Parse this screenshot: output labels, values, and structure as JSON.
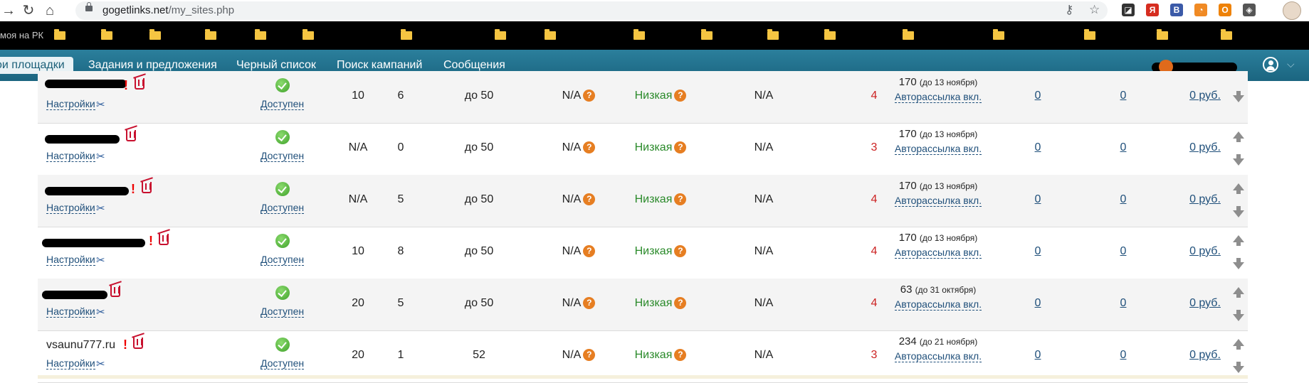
{
  "browser": {
    "url_host": "gogetlinks.net",
    "url_path": "/my_sites.php",
    "bookmarks_first": "моя на РК"
  },
  "nav": {
    "tabs": [
      {
        "label": "ои площадки",
        "active": true
      },
      {
        "label": "Задания и предложения",
        "active": false
      },
      {
        "label": "Черный список",
        "active": false
      },
      {
        "label": "Поиск кампаний",
        "active": false
      },
      {
        "label": "Сообщения",
        "active": false
      }
    ]
  },
  "table": {
    "settings_label": "Настройки",
    "status_label": "Доступен",
    "autosend_label": "Авторассылка вкл.",
    "rows": [
      {
        "site": "",
        "c1": "10",
        "c2": "6",
        "limit": "до 50",
        "na1": "N/A",
        "level": "Низкая",
        "na2": "N/A",
        "score": "4",
        "price": "170",
        "until": "(до 13 ноября)",
        "l1": "0",
        "l2": "0",
        "money": "0 руб."
      },
      {
        "site": "",
        "c1": "N/A",
        "c2": "0",
        "limit": "до 50",
        "na1": "N/A",
        "level": "Низкая",
        "na2": "N/A",
        "score": "3",
        "price": "170",
        "until": "(до 13 ноября)",
        "l1": "0",
        "l2": "0",
        "money": "0 руб."
      },
      {
        "site": "",
        "c1": "N/A",
        "c2": "5",
        "limit": "до 50",
        "na1": "N/A",
        "level": "Низкая",
        "na2": "N/A",
        "score": "4",
        "price": "170",
        "until": "(до 13 ноября)",
        "l1": "0",
        "l2": "0",
        "money": "0 руб."
      },
      {
        "site": "",
        "c1": "10",
        "c2": "8",
        "limit": "до 50",
        "na1": "N/A",
        "level": "Низкая",
        "na2": "N/A",
        "score": "4",
        "price": "170",
        "until": "(до 13 ноября)",
        "l1": "0",
        "l2": "0",
        "money": "0 руб."
      },
      {
        "site": "",
        "c1": "20",
        "c2": "5",
        "limit": "до 50",
        "na1": "N/A",
        "level": "Низкая",
        "na2": "N/A",
        "score": "4",
        "price": "63",
        "until": "(до 31 октября)",
        "l1": "0",
        "l2": "0",
        "money": "0 руб."
      },
      {
        "site": "vsaunu777.ru",
        "c1": "20",
        "c2": "1",
        "limit": "52",
        "na1": "N/A",
        "level": "Низкая",
        "na2": "N/A",
        "score": "3",
        "price": "234",
        "until": "(до 21 ноября)",
        "l1": "0",
        "l2": "0",
        "money": "0 руб."
      }
    ]
  },
  "colors": {
    "nav_bar": "#1b6580",
    "low_level": "#2a8a2a",
    "score_red": "#cc2222",
    "link": "#1f4f7a",
    "help": "#e67e22"
  },
  "icons": [
    "back-arrow-icon",
    "reload-icon",
    "home-icon",
    "lock-icon",
    "key-icon",
    "star-icon",
    "trash-icon",
    "tools-icon",
    "check-circle-icon",
    "help-icon",
    "arrow-up-icon",
    "arrow-down-icon",
    "user-icon",
    "chevron-down-icon"
  ]
}
